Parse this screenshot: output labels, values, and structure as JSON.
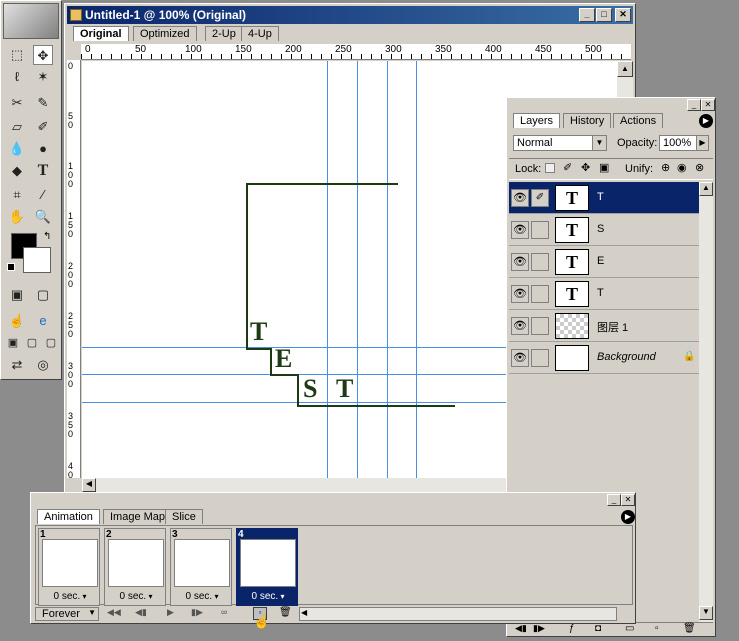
{
  "document": {
    "title": "Untitled-1 @ 100% (Original)",
    "tabs": [
      "Original",
      "Optimized",
      "2-Up",
      "4-Up"
    ],
    "active_tab": "Original",
    "ruler_h_labels": [
      "0",
      "50",
      "100",
      "150",
      "200",
      "250",
      "300",
      "350",
      "400",
      "450",
      "500"
    ],
    "ruler_v_labels": [
      "0",
      "5 0",
      "1 0 0",
      "1 5 0",
      "2 0 0",
      "2 5 0",
      "3 0 0",
      "3 5 0",
      "4 0 0"
    ],
    "canvas_letters": [
      "T",
      "E",
      "S",
      "T"
    ]
  },
  "layers_panel": {
    "tabs": [
      "Layers",
      "History",
      "Actions"
    ],
    "blend_mode": "Normal",
    "opacity_label": "Opacity:",
    "opacity_value": "100%",
    "lock_label": "Lock:",
    "unify_label": "Unify:",
    "layers": [
      {
        "thumb": "T",
        "name": "T",
        "selected": true
      },
      {
        "thumb": "T",
        "name": "S",
        "selected": false
      },
      {
        "thumb": "T",
        "name": "E",
        "selected": false
      },
      {
        "thumb": "T",
        "name": "T",
        "selected": false
      },
      {
        "thumb": "",
        "name": "图层 1",
        "selected": false
      },
      {
        "thumb": "",
        "name": "Background",
        "selected": false
      }
    ]
  },
  "animation_panel": {
    "tabs": [
      "Animation",
      "Image Map",
      "Slice"
    ],
    "frames": [
      {
        "num": "1",
        "delay": "0 sec."
      },
      {
        "num": "2",
        "delay": "0 sec."
      },
      {
        "num": "3",
        "delay": "0 sec."
      },
      {
        "num": "4",
        "delay": "0 sec."
      }
    ],
    "loop": "Forever"
  },
  "colors": {
    "title_dark": "#0a246a",
    "title_light": "#3a6ea5",
    "panel": "#d4d0c8",
    "guide": "#4a90e2",
    "path": "#1e3a14"
  },
  "icons": [
    "window-min-icon",
    "window-max-icon",
    "close-icon",
    "eye-icon",
    "brush-icon",
    "lock-icon",
    "play-icon",
    "delete-icon",
    "hand-cursor-icon"
  ]
}
